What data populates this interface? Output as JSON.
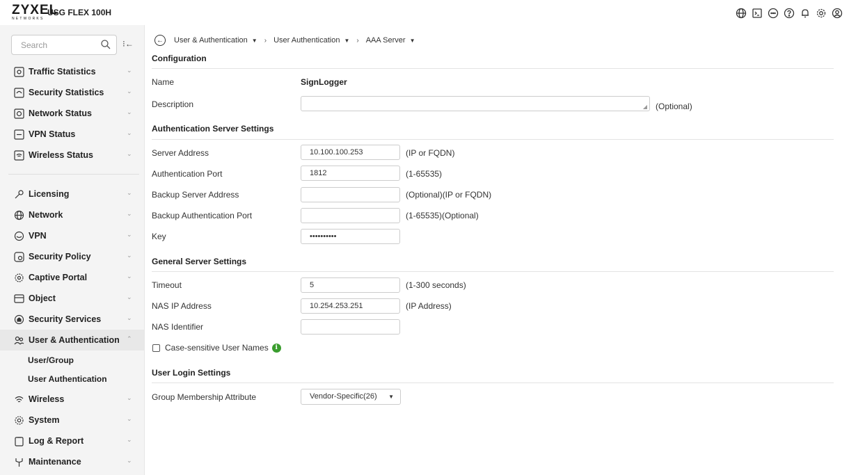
{
  "brand": {
    "name": "ZYXEL",
    "sub": "NETWORKS",
    "model": "USG FLEX 100H"
  },
  "top_icons": [
    "globe-icon",
    "terminal-icon",
    "chat-icon",
    "help-icon",
    "bell-icon",
    "settings-icon",
    "user-icon"
  ],
  "sidebar": {
    "search_placeholder": "Search",
    "items_top": [
      {
        "label": "Traffic Statistics",
        "icon": "traffic-icon"
      },
      {
        "label": "Security Statistics",
        "icon": "security-stats-icon"
      },
      {
        "label": "Network Status",
        "icon": "network-status-icon"
      },
      {
        "label": "VPN Status",
        "icon": "vpn-status-icon"
      },
      {
        "label": "Wireless Status",
        "icon": "wireless-status-icon"
      }
    ],
    "items_main": [
      {
        "label": "Licensing",
        "icon": "key-icon"
      },
      {
        "label": "Network",
        "icon": "globe-icon"
      },
      {
        "label": "VPN",
        "icon": "shield-icon"
      },
      {
        "label": "Security Policy",
        "icon": "policy-icon"
      },
      {
        "label": "Captive Portal",
        "icon": "portal-icon"
      },
      {
        "label": "Object",
        "icon": "object-icon"
      },
      {
        "label": "Security Services",
        "icon": "services-icon"
      },
      {
        "label": "User & Authentication",
        "icon": "users-icon"
      },
      {
        "label": "Wireless",
        "icon": "wifi-icon"
      },
      {
        "label": "System",
        "icon": "gear-icon"
      },
      {
        "label": "Log & Report",
        "icon": "clipboard-icon"
      },
      {
        "label": "Maintenance",
        "icon": "wrench-icon"
      }
    ],
    "sub_items": [
      "User/Group",
      "User Authentication"
    ]
  },
  "breadcrumb": [
    "User & Authentication",
    "User Authentication",
    "AAA Server"
  ],
  "config": {
    "title": "Configuration",
    "name_label": "Name",
    "name_value": "SignLogger",
    "description_label": "Description",
    "description_hint": "(Optional)"
  },
  "auth": {
    "title": "Authentication Server Settings",
    "server_address_label": "Server Address",
    "server_address_value": "10.100.100.253",
    "server_address_hint": "(IP or FQDN)",
    "port_label": "Authentication Port",
    "port_value": "1812",
    "port_hint": "(1-65535)",
    "backup_address_label": "Backup Server Address",
    "backup_address_hint": "(Optional)(IP or FQDN)",
    "backup_port_label": "Backup Authentication Port",
    "backup_port_hint": "(1-65535)(Optional)",
    "key_label": "Key",
    "key_value": "••••••••••"
  },
  "general": {
    "title": "General Server Settings",
    "timeout_label": "Timeout",
    "timeout_value": "5",
    "timeout_hint": "(1-300 seconds)",
    "nas_ip_label": "NAS IP Address",
    "nas_ip_value": "10.254.253.251",
    "nas_ip_hint": "(IP Address)",
    "nas_id_label": "NAS Identifier",
    "case_sensitive_label": "Case-sensitive User Names"
  },
  "login": {
    "title": "User Login Settings",
    "group_label": "Group Membership Attribute",
    "group_value": "Vendor-Specific(26)"
  }
}
